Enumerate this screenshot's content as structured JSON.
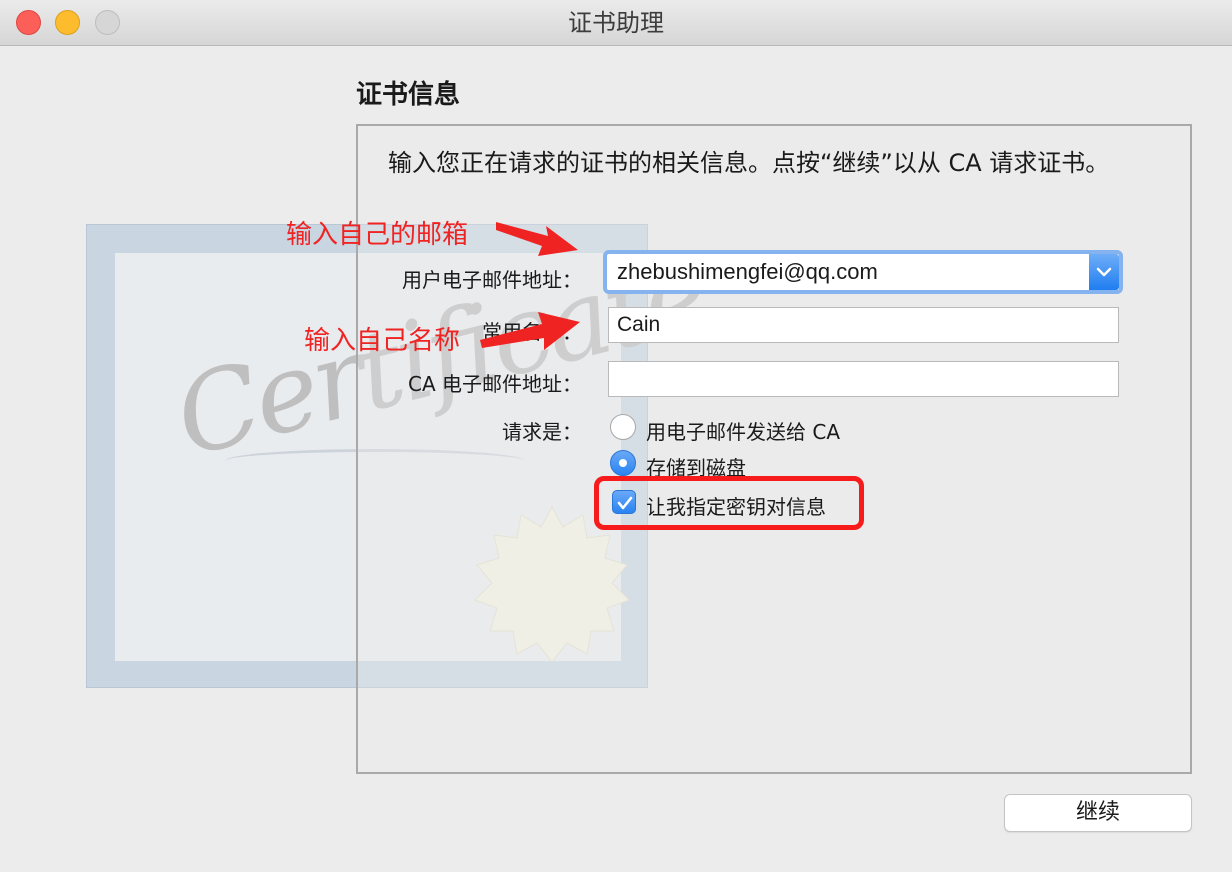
{
  "window": {
    "title": "证书助理"
  },
  "section": {
    "title": "证书信息"
  },
  "description": "输入您正在请求的证书的相关信息。点按“继续”以从 CA 请求证书。",
  "form": {
    "email": {
      "label": "用户电子邮件地址：",
      "value": "zhebushimengfei@qq.com"
    },
    "common_name": {
      "label": "常用名称：",
      "value": "Cain"
    },
    "ca_email": {
      "label": "CA 电子邮件地址：",
      "value": ""
    },
    "request": {
      "label": "请求是：",
      "options": [
        {
          "label": "用电子邮件发送给 CA",
          "selected": false
        },
        {
          "label": "存储到磁盘",
          "selected": true
        }
      ]
    },
    "keypair_checkbox": {
      "label": "让我指定密钥对信息",
      "checked": true
    }
  },
  "annotations": {
    "email_note": "输入自己的邮箱",
    "name_note": "输入自己名称",
    "color": "#f02323"
  },
  "background": {
    "cert_script": "Certificate"
  },
  "buttons": {
    "continue": "继续"
  },
  "colors": {
    "accent": "#2a83f2",
    "highlight": "#f81b1b"
  }
}
